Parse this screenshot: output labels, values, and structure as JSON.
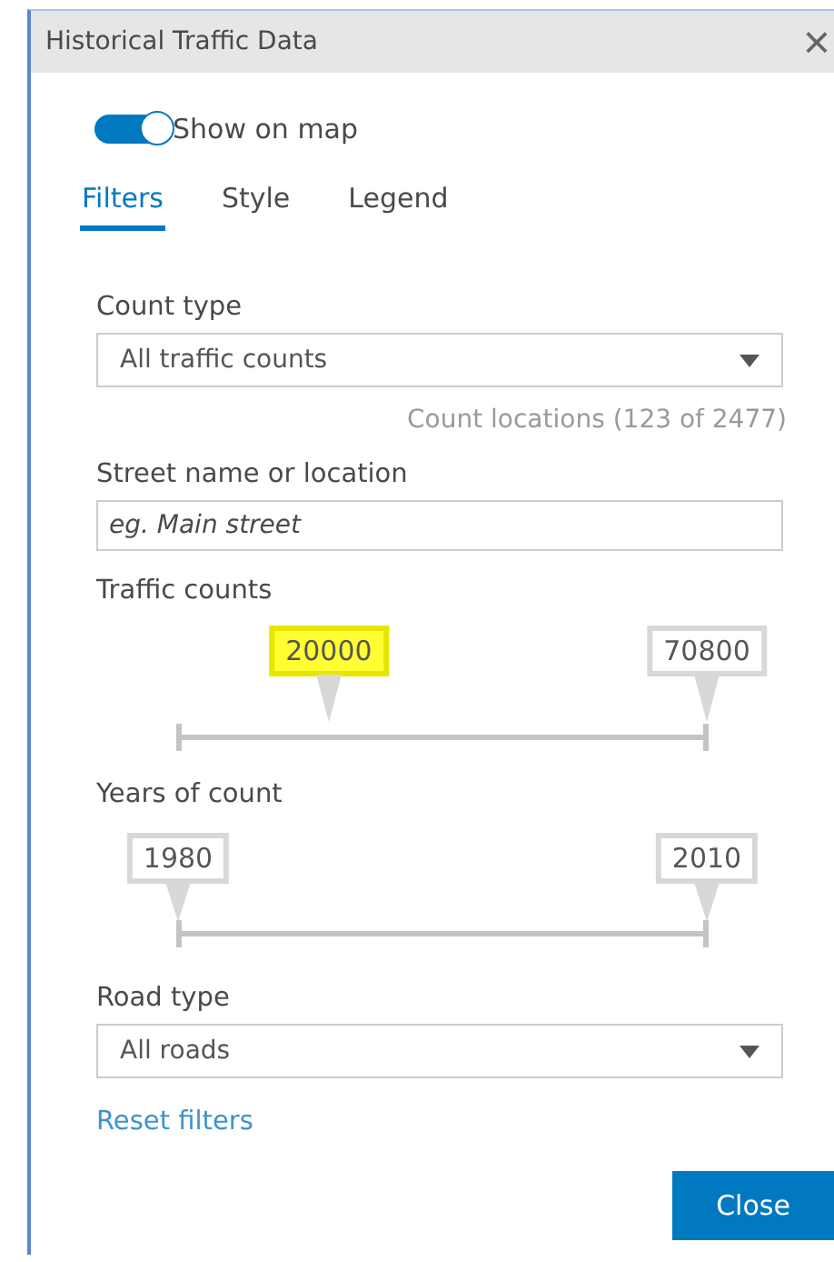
{
  "window": {
    "title": "Historical Traffic Data",
    "close": "×"
  },
  "toggle": {
    "label": "Show on map",
    "on": true
  },
  "tabs": [
    {
      "label": "Filters",
      "selected": true
    },
    {
      "label": "Style",
      "selected": false
    },
    {
      "label": "Legend",
      "selected": false
    }
  ],
  "count_type": {
    "label": "Count type",
    "value": "All traffic counts",
    "note": "Count locations (123 of 2477)"
  },
  "street": {
    "label": "Street name or location",
    "placeholder": "eg. Main street"
  },
  "sliders": [
    {
      "label": "Traffic counts",
      "thumbs": [
        {
          "value": "20000",
          "level": 0.285,
          "highlighted": true
        },
        {
          "value": "70800",
          "level": 1,
          "highlighted": false
        }
      ]
    },
    {
      "label": "Years of count",
      "thumbs": [
        {
          "value": "1980",
          "level": 0,
          "highlighted": false
        },
        {
          "value": "2010",
          "level": 1,
          "highlighted": false
        }
      ]
    }
  ],
  "road_type": {
    "label": "Road type",
    "value": "All roads"
  },
  "reset_link": "Reset filters",
  "buttons": [
    "Close"
  ]
}
